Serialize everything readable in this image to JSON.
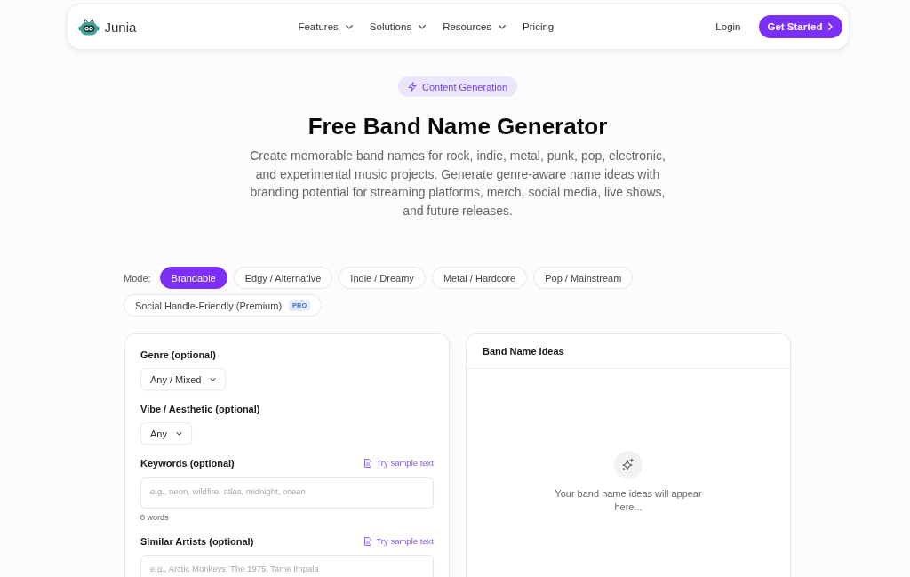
{
  "nav": {
    "brand": "Junia",
    "items": [
      {
        "label": "Features",
        "dropdown": true
      },
      {
        "label": "Solutions",
        "dropdown": true
      },
      {
        "label": "Resources",
        "dropdown": true
      },
      {
        "label": "Pricing",
        "dropdown": false
      }
    ],
    "login": "Login",
    "cta": "Get Started"
  },
  "hero": {
    "badge": "Content Generation",
    "title": "Free Band Name Generator",
    "description": "Create memorable band names for rock, indie, metal, punk, pop, electronic, and experimental music projects. Generate genre-aware name ideas with branding potential for streaming platforms, merch, social media, live shows, and future releases."
  },
  "modes": {
    "label": "Mode:",
    "options": [
      {
        "label": "Brandable",
        "selected": true
      },
      {
        "label": "Edgy / Alternative",
        "selected": false
      },
      {
        "label": "Indie / Dreamy",
        "selected": false
      },
      {
        "label": "Metal / Hardcore",
        "selected": false
      },
      {
        "label": "Pop / Mainstream",
        "selected": false
      },
      {
        "label": "Social Handle-Friendly (Premium)",
        "selected": false,
        "badge": "PRO"
      }
    ]
  },
  "form": {
    "fields": [
      {
        "kind": "select",
        "label": "Genre (optional)",
        "value": "Any / Mixed"
      },
      {
        "kind": "select",
        "label": "Vibe / Aesthetic (optional)",
        "value": "Any"
      },
      {
        "kind": "text",
        "label": "Keywords (optional)",
        "action": "Try sample text",
        "placeholder": "e.g., neon, wildfire, atlas, midnight, ocean",
        "count": "0 words"
      },
      {
        "kind": "text",
        "label": "Similar Artists (optional)",
        "action": "Try sample text",
        "placeholder": "e.g., Arctic Monkeys, The 1975, Tame Impala"
      }
    ]
  },
  "results": {
    "title": "Band Name Ideas",
    "empty_message": "Your band name ideas will appear here..."
  }
}
